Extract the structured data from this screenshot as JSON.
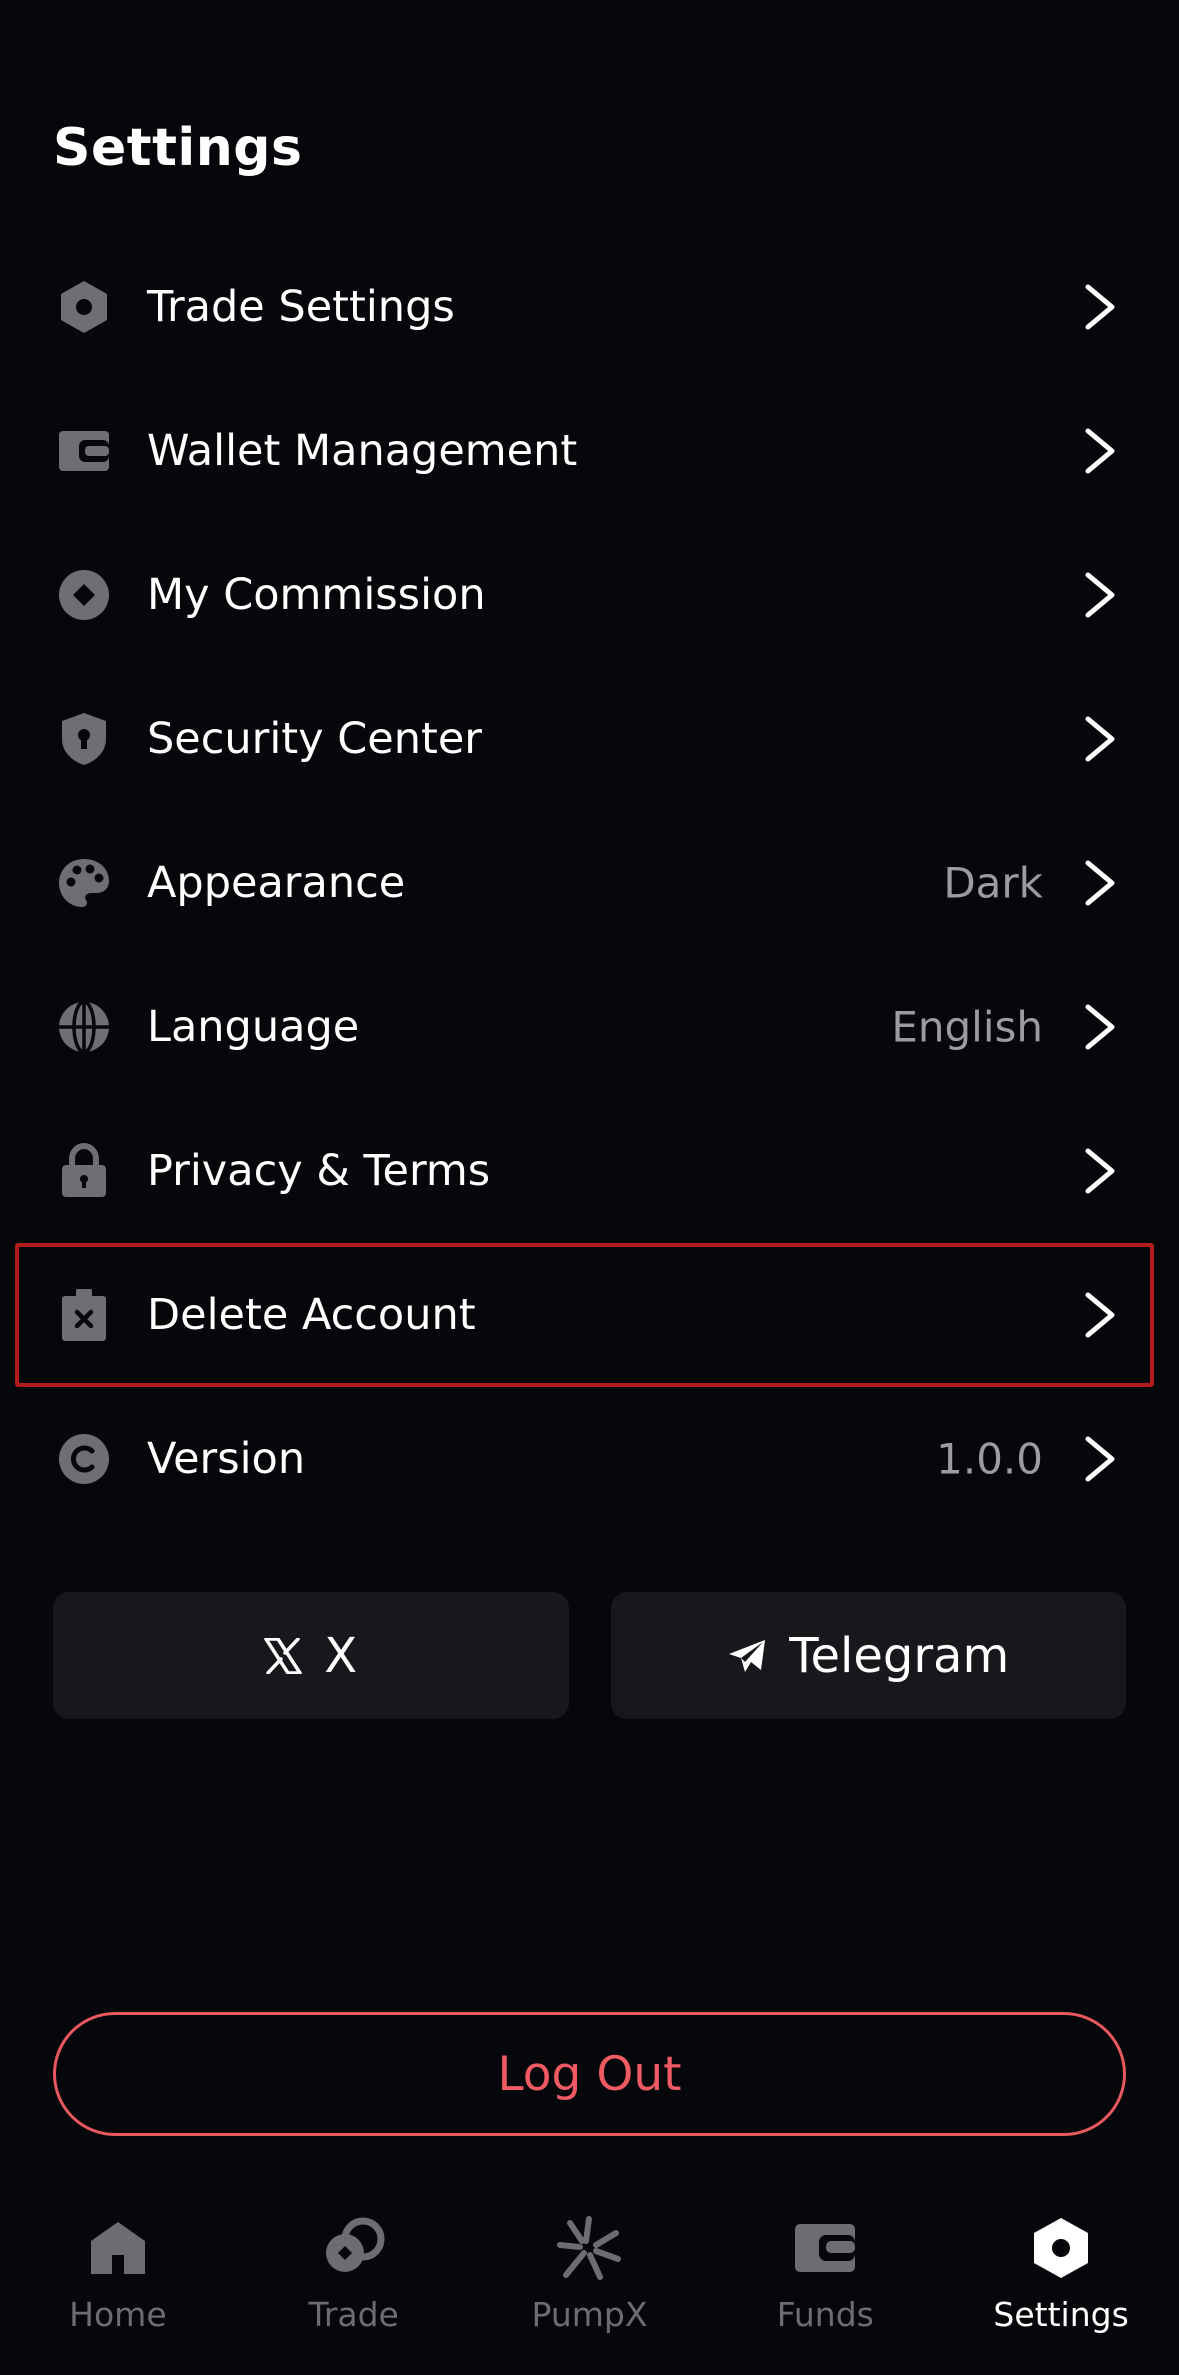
{
  "header": {
    "title": "Settings"
  },
  "menu": {
    "items": [
      {
        "label": "Trade Settings",
        "value": ""
      },
      {
        "label": "Wallet Management",
        "value": ""
      },
      {
        "label": "My Commission",
        "value": ""
      },
      {
        "label": "Security Center",
        "value": ""
      },
      {
        "label": "Appearance",
        "value": "Dark"
      },
      {
        "label": "Language",
        "value": "English"
      },
      {
        "label": "Privacy & Terms",
        "value": ""
      },
      {
        "label": "Delete Account",
        "value": ""
      },
      {
        "label": "Version",
        "value": "1.0.0"
      }
    ]
  },
  "social": {
    "x_label": "X",
    "telegram_label": "Telegram"
  },
  "logout": {
    "label": "Log Out"
  },
  "tabbar": {
    "tabs": [
      {
        "label": "Home",
        "icon": "home-icon"
      },
      {
        "label": "Trade",
        "icon": "trade-icon"
      },
      {
        "label": "PumpX",
        "icon": "pumpx-icon"
      },
      {
        "label": "Funds",
        "icon": "wallet-icon"
      },
      {
        "label": "Settings",
        "icon": "settings-hex-icon"
      }
    ],
    "active": "Settings"
  },
  "colors": {
    "background": "#05070a",
    "icon_gray": "#6d6f74",
    "value_gray": "#9a9ca1",
    "card": "#17181c",
    "logout_red": "#ef5a63",
    "highlight_border": "#b31c1c"
  }
}
